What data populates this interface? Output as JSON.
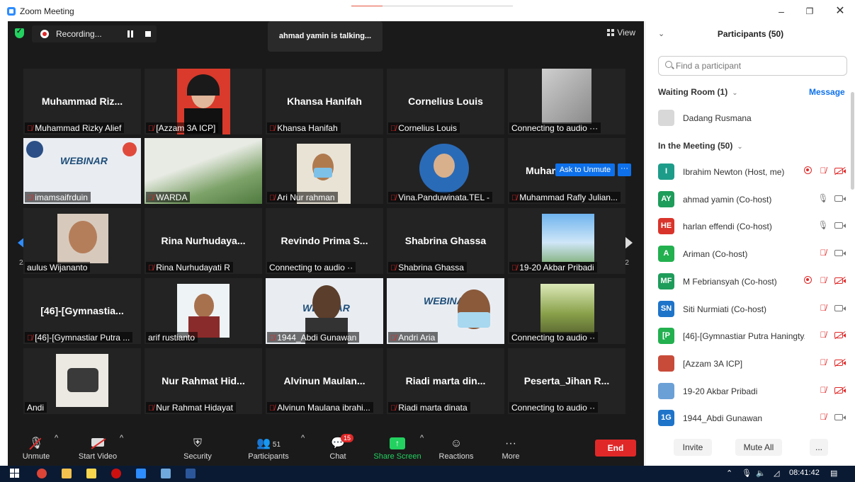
{
  "window": {
    "title": "Zoom Meeting"
  },
  "meeting": {
    "recording_label": "Recording...",
    "talking_text": "ahmad yamin is talking...",
    "view_label": "View",
    "ask_to_unmute": "Ask to Unmute",
    "ask_more": "···",
    "page_indicator": "2/2"
  },
  "tiles": [
    {
      "big": "Muhammad Riz...",
      "label": "Muhammad Rizky Alief",
      "muted": true
    },
    {
      "big": "",
      "label": "[Azzam 3A ICP]",
      "muted": true
    },
    {
      "big": "Khansa Hanifah",
      "label": "Khansa Hanifah",
      "muted": true
    },
    {
      "big": "Cornelius Louis",
      "label": "Cornelius Louis",
      "muted": true
    },
    {
      "big": "",
      "label": "Connecting to audio ···",
      "muted": false
    },
    {
      "big": "",
      "label": "imamsaifrduin",
      "muted": true
    },
    {
      "big": "",
      "label": "WARDA",
      "muted": true
    },
    {
      "big": "",
      "label": "Ari Nur rahman",
      "muted": true
    },
    {
      "big": "",
      "label": "Vina.Panduwinata.TEL -",
      "muted": true
    },
    {
      "big": "Muhammad Raf...",
      "label": "Muhammad Rafly Julian...",
      "muted": true
    },
    {
      "big": "",
      "label": "aulus Wijananto",
      "muted": false
    },
    {
      "big": "Rina  Nurhudaya...",
      "label": "Rina Nurhudayati R",
      "muted": true
    },
    {
      "big": "Revindo  Prima  S...",
      "label": "Connecting to audio ··",
      "muted": false
    },
    {
      "big": "Shabrina Ghassa",
      "label": "Shabrina Ghassa",
      "muted": true
    },
    {
      "big": "",
      "label": "19-20 Akbar Pribadi",
      "muted": true
    },
    {
      "big": "[46]-[Gymnastia...",
      "label": "[46]-[Gymnastiar Putra ...",
      "muted": true
    },
    {
      "big": "",
      "label": "arif rustianto",
      "muted": false
    },
    {
      "big": "",
      "label": "1944_Abdi Gunawan",
      "muted": true
    },
    {
      "big": "",
      "label": "Andri Aria",
      "muted": true
    },
    {
      "big": "",
      "label": "Connecting to audio ··",
      "muted": false
    },
    {
      "big": "",
      "label": "Andi",
      "muted": false
    },
    {
      "big": "Nur Rahmat Hid...",
      "label": "Nur Rahmat Hidayat",
      "muted": true
    },
    {
      "big": "Alvinun  Maulan...",
      "label": "Alvinun Maulana ibrahi...",
      "muted": true
    },
    {
      "big": "Riadi marta din...",
      "label": "Riadi marta dinata",
      "muted": true
    },
    {
      "big": "Peserta_Jihan R...",
      "label": "Connecting to audio ··",
      "muted": false
    }
  ],
  "webinar_text": "WEBINAR",
  "toolbar": {
    "unmute": "Unmute",
    "start_video": "Start Video",
    "security": "Security",
    "participants": "Participants",
    "participants_count": "51",
    "chat": "Chat",
    "chat_badge": "15",
    "share_screen": "Share Screen",
    "reactions": "Reactions",
    "more": "More",
    "end": "End"
  },
  "panel": {
    "title": "Participants (50)",
    "search_placeholder": "Find a participant",
    "waiting_room": "Waiting Room (1)",
    "message": "Message",
    "waiting_person": "Dadang Rusmana",
    "in_meeting": "In the Meeting (50)",
    "participants": [
      {
        "initials": "I",
        "name": "Ibrahim Newton (Host, me)",
        "color": "#1e9c8a",
        "rec": true,
        "mic_muted": true,
        "cam_off": true
      },
      {
        "initials": "AY",
        "name": "ahmad yamin (Co-host)",
        "color": "#1e9c5a",
        "rec": false,
        "mic_muted": false,
        "cam_off": false
      },
      {
        "initials": "HE",
        "name": "harlan effendi (Co-host)",
        "color": "#d9342b",
        "rec": false,
        "mic_muted": false,
        "cam_off": false
      },
      {
        "initials": "A",
        "name": "Ariman (Co-host)",
        "color": "#23b04f",
        "rec": false,
        "mic_muted": true,
        "cam_off": false
      },
      {
        "initials": "MF",
        "name": "M Febriansyah (Co-host)",
        "color": "#1e9c5a",
        "rec": true,
        "mic_muted": true,
        "cam_off": true
      },
      {
        "initials": "SN",
        "name": "Siti Nurmiati (Co-host)",
        "color": "#1e74c9",
        "rec": false,
        "mic_muted": true,
        "cam_off": false
      },
      {
        "initials": "[P",
        "name": "[46]-[Gymnastiar Putra Haningty...",
        "color": "#23b04f",
        "rec": false,
        "mic_muted": true,
        "cam_off": true
      },
      {
        "initials": "",
        "name": "[Azzam 3A ICP]",
        "color": "#c84b3a",
        "rec": false,
        "mic_muted": true,
        "cam_off": true
      },
      {
        "initials": "",
        "name": "19-20 Akbar Pribadi",
        "color": "#6ba0d6",
        "rec": false,
        "mic_muted": true,
        "cam_off": true
      },
      {
        "initials": "1G",
        "name": "1944_Abdi Gunawan",
        "color": "#1e74c9",
        "rec": false,
        "mic_muted": true,
        "cam_off": false
      }
    ],
    "invite": "Invite",
    "mute_all": "Mute All",
    "more": "..."
  },
  "taskbar": {
    "time": "08:41:42"
  }
}
